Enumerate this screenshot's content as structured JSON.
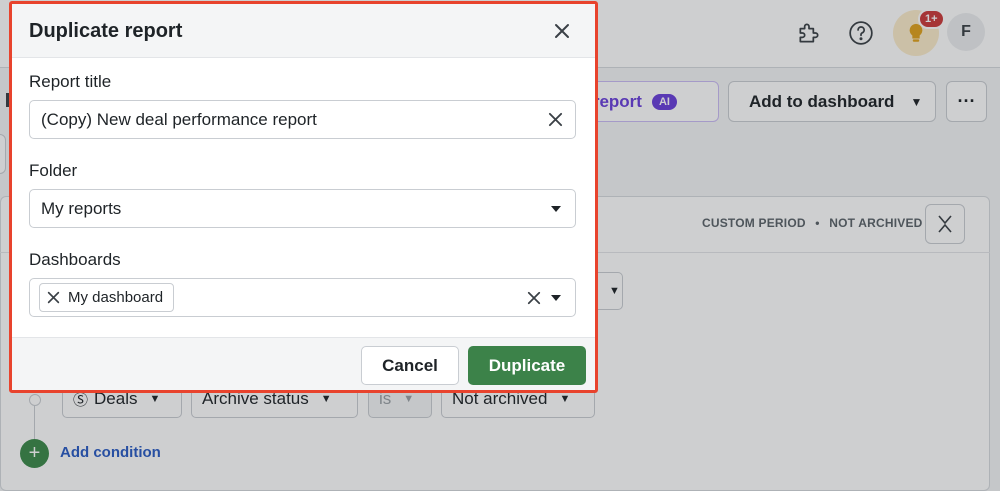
{
  "topbar": {
    "extensions_icon": "puzzle-icon",
    "help_icon": "help-circle-icon",
    "tips_icon": "lightbulb-icon",
    "notification_badge": "1+",
    "avatar_initial": "F"
  },
  "toolbar": {
    "generate_report_label": "te report",
    "ai_badge": "AI",
    "add_to_dashboard_label": "Add to dashboard",
    "more_label": "···"
  },
  "report_panel": {
    "period_label": "CUSTOM PERIOD",
    "separator": "•",
    "archive_label": "NOT ARCHIVED",
    "filter": {
      "entity": "Deals",
      "field": "Archive status",
      "operator": "is",
      "value": "Not archived"
    },
    "add_condition_label": "Add condition"
  },
  "modal": {
    "title": "Duplicate report",
    "report_title_label": "Report title",
    "report_title_value": "(Copy) New deal performance report",
    "folder_label": "Folder",
    "folder_value": "My reports",
    "dashboards_label": "Dashboards",
    "dashboards_selected": [
      "My dashboard"
    ],
    "cancel_label": "Cancel",
    "duplicate_label": "Duplicate"
  },
  "colors": {
    "highlight_border": "#e8432d",
    "primary_green": "#3c8249",
    "ai_purple": "#6a3fdb",
    "link_blue": "#2a5cc4"
  }
}
